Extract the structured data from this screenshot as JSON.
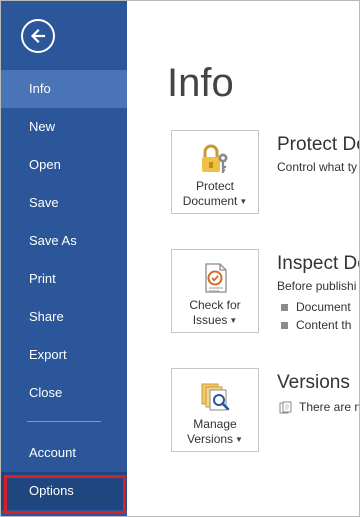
{
  "sidebar": {
    "back_icon": "back-arrow-icon",
    "items": [
      {
        "label": "Info",
        "active": true
      },
      {
        "label": "New"
      },
      {
        "label": "Open"
      },
      {
        "label": "Save"
      },
      {
        "label": "Save As"
      },
      {
        "label": "Print"
      },
      {
        "label": "Share"
      },
      {
        "label": "Export"
      },
      {
        "label": "Close"
      }
    ],
    "bottom_items": [
      {
        "label": "Account"
      },
      {
        "label": "Options"
      }
    ]
  },
  "main": {
    "title": "Info",
    "sections": [
      {
        "tile_label_line1": "Protect",
        "tile_label_line2": "Document",
        "icon": "lock-key-icon",
        "title": "Protect Do",
        "description": "Control what ty"
      },
      {
        "tile_label_line1": "Check for",
        "tile_label_line2": "Issues",
        "icon": "inspect-document-icon",
        "title": "Inspect Do",
        "description": "Before publishi",
        "bullets": [
          "Document",
          "Content th"
        ]
      },
      {
        "tile_label_line1": "Manage",
        "tile_label_line2": "Versions",
        "icon": "manage-versions-icon",
        "title": "Versions",
        "note": "There are n"
      }
    ]
  },
  "colors": {
    "sidebar_bg": "#2b579a",
    "active_item_bg": "#4a74b8",
    "highlight_border": "#d9202a"
  }
}
